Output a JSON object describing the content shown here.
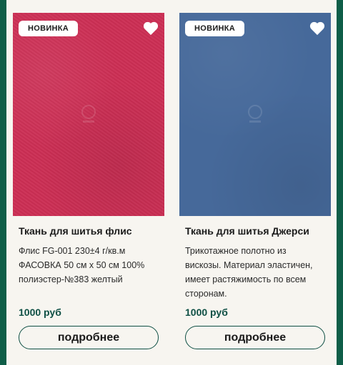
{
  "theme": {
    "accent": "#0e4f44",
    "edge": "#0e5e48"
  },
  "products": [
    {
      "badge": "НОВИНКА",
      "image": {
        "color": "#cc2e54",
        "description_icon": "fabric-swatch"
      },
      "title": "Ткань для шитья флис",
      "desc_lines": [
        "Флис FG-001 230±4 г/кв.м",
        "ФАСОВКА 50 см х 50 см 100%",
        "полиэстер-№383 желтый"
      ],
      "price": "1000 руб",
      "button": "подробнее",
      "favorite_icon": "heart-icon"
    },
    {
      "badge": "НОВИНКА",
      "image": {
        "color": "#46699a",
        "description_icon": "fabric-swatch"
      },
      "title": "Ткань для шитья Джерси",
      "desc_lines": [
        "Трикотажное полотно из",
        "вискозы. Материал эластичен,",
        "имеет растяжимость по всем",
        "сторонам."
      ],
      "price": "1000 руб",
      "button": "подробнее",
      "favorite_icon": "heart-icon"
    }
  ]
}
